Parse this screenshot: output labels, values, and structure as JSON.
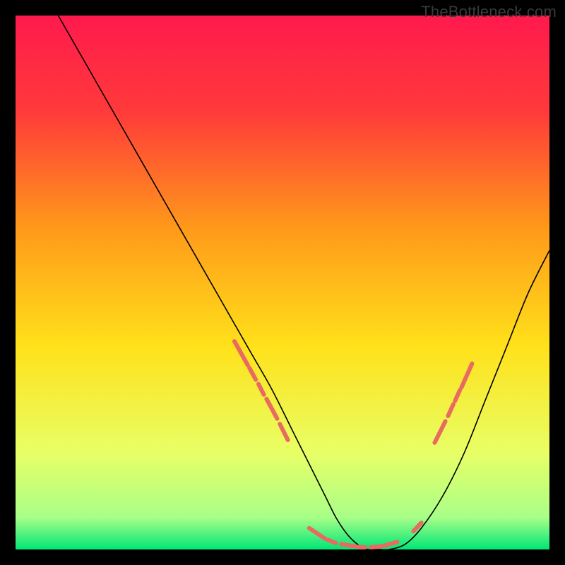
{
  "watermark": "TheBottleneck.com",
  "chart_data": {
    "type": "line",
    "title": "",
    "xlabel": "",
    "ylabel": "",
    "xlim": [
      0,
      100
    ],
    "ylim": [
      0,
      100
    ],
    "background_gradient_stops": [
      {
        "offset": 0.0,
        "color": "#ff1a4d"
      },
      {
        "offset": 0.18,
        "color": "#ff3a3a"
      },
      {
        "offset": 0.4,
        "color": "#ff9a1a"
      },
      {
        "offset": 0.62,
        "color": "#ffe11a"
      },
      {
        "offset": 0.82,
        "color": "#e8ff66"
      },
      {
        "offset": 0.94,
        "color": "#a8ff88"
      },
      {
        "offset": 1.0,
        "color": "#00e676"
      }
    ],
    "series": [
      {
        "name": "bottleneck-curve",
        "color": "#000000",
        "x": [
          8,
          12,
          16,
          20,
          24,
          28,
          32,
          36,
          40,
          44,
          48,
          52,
          54,
          56,
          58,
          60,
          62,
          64,
          66,
          68,
          70,
          73,
          76,
          80,
          84,
          88,
          92,
          96,
          100
        ],
        "y": [
          100,
          93,
          86,
          79,
          72,
          65,
          58,
          51,
          44,
          37,
          30,
          22,
          18,
          14,
          10,
          6,
          3,
          1,
          0,
          0,
          0,
          1,
          4,
          10,
          18,
          28,
          38,
          48,
          56
        ]
      }
    ],
    "segment_markers": {
      "name": "congested-segments",
      "color": "#e86a60",
      "width": 6,
      "segments": [
        {
          "x0": 41.0,
          "y0": 39.0,
          "x1": 43.5,
          "y1": 34.5
        },
        {
          "x0": 43.8,
          "y0": 34.0,
          "x1": 45.0,
          "y1": 31.8
        },
        {
          "x0": 45.5,
          "y0": 31.0,
          "x1": 46.5,
          "y1": 29.0
        },
        {
          "x0": 47.0,
          "y0": 28.2,
          "x1": 49.0,
          "y1": 24.5
        },
        {
          "x0": 49.5,
          "y0": 23.5,
          "x1": 51.0,
          "y1": 20.5
        },
        {
          "x0": 55.0,
          "y0": 4.0,
          "x1": 58.0,
          "y1": 2.0
        },
        {
          "x0": 58.5,
          "y0": 1.8,
          "x1": 60.0,
          "y1": 1.2
        },
        {
          "x0": 61.0,
          "y0": 1.0,
          "x1": 63.5,
          "y1": 0.6
        },
        {
          "x0": 64.0,
          "y0": 0.5,
          "x1": 65.5,
          "y1": 0.4
        },
        {
          "x0": 66.5,
          "y0": 0.4,
          "x1": 68.5,
          "y1": 0.6
        },
        {
          "x0": 69.0,
          "y0": 0.7,
          "x1": 71.5,
          "y1": 1.4
        },
        {
          "x0": 74.5,
          "y0": 3.4,
          "x1": 76.0,
          "y1": 5.0
        },
        {
          "x0": 78.5,
          "y0": 20.0,
          "x1": 80.5,
          "y1": 24.0
        },
        {
          "x0": 81.0,
          "y0": 25.0,
          "x1": 82.0,
          "y1": 27.2
        },
        {
          "x0": 82.3,
          "y0": 27.8,
          "x1": 83.2,
          "y1": 29.8
        },
        {
          "x0": 83.5,
          "y0": 30.3,
          "x1": 85.5,
          "y1": 34.8
        }
      ]
    }
  }
}
